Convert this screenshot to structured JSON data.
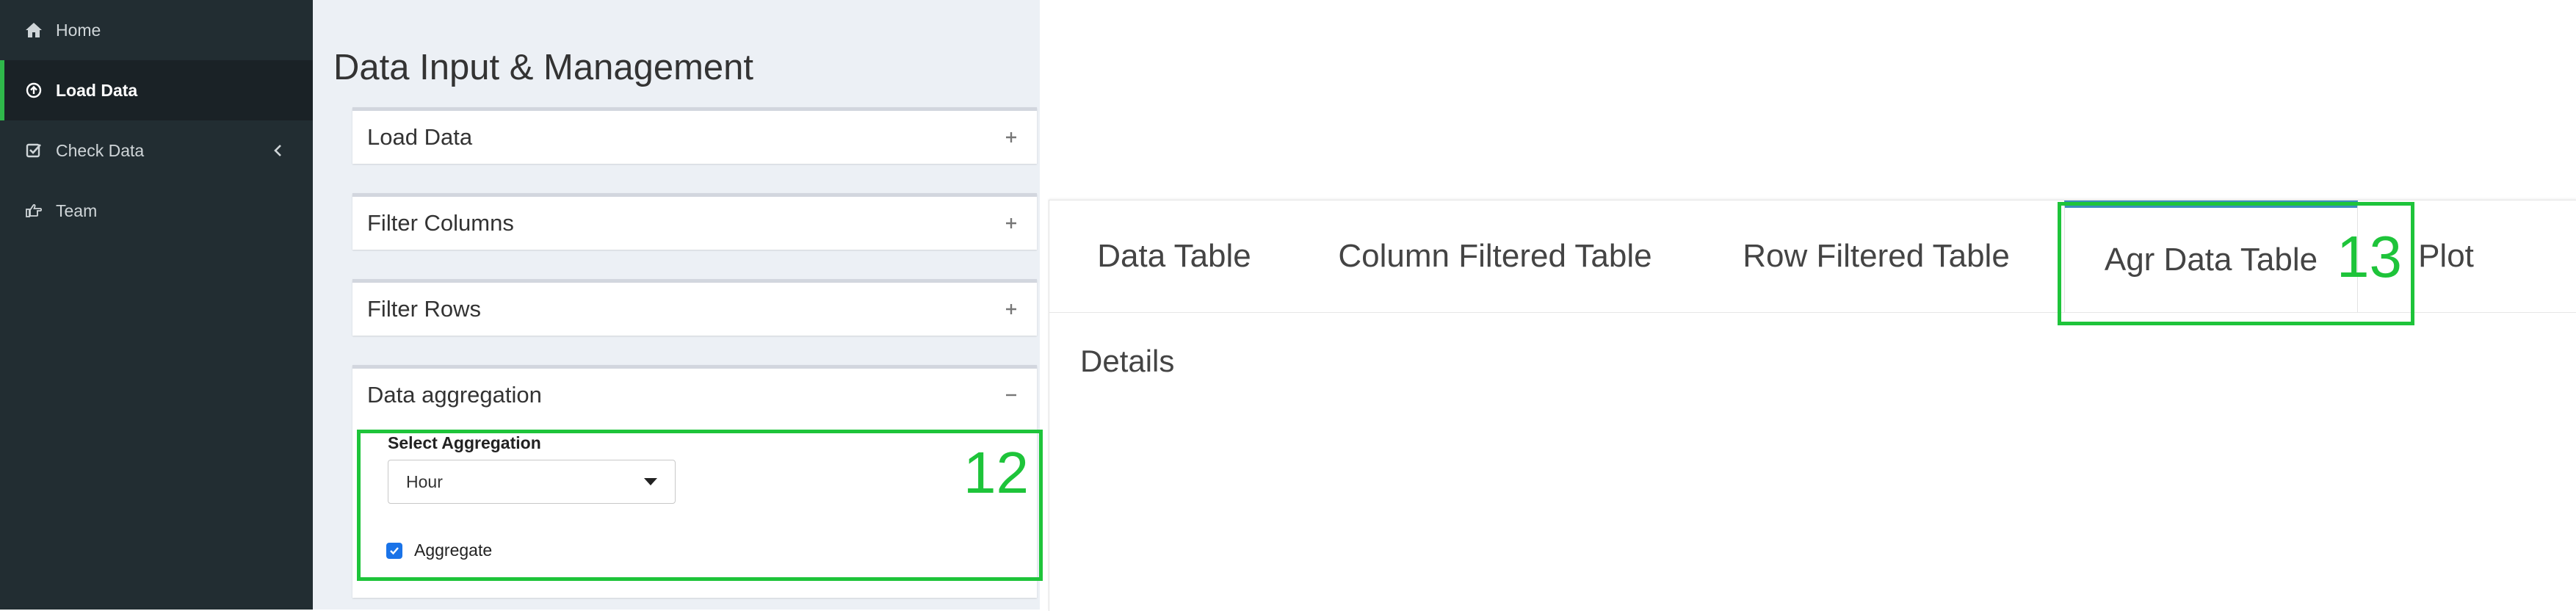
{
  "sidebar": {
    "items": [
      {
        "label": "Home",
        "icon": "home-icon",
        "active": false
      },
      {
        "label": "Load Data",
        "icon": "upload-circle-icon",
        "active": true
      },
      {
        "label": "Check Data",
        "icon": "check-square-icon",
        "active": false,
        "has_submenu": true
      },
      {
        "label": "Team",
        "icon": "hand-pointing-icon",
        "active": false
      }
    ]
  },
  "page": {
    "title": "Data Input & Management"
  },
  "boxes": [
    {
      "title": "Load Data",
      "collapsed": true
    },
    {
      "title": "Filter Columns",
      "collapsed": true
    },
    {
      "title": "Filter Rows",
      "collapsed": true
    },
    {
      "title": "Data aggregation",
      "collapsed": false
    }
  ],
  "aggregation": {
    "select_label": "Select Aggregation",
    "selected_value": "Hour",
    "checkbox_label": "Aggregate",
    "checkbox_checked": true
  },
  "annotations": {
    "left_number": "12",
    "right_number": "13",
    "color": "#1ec43a"
  },
  "tabs": {
    "items": [
      {
        "label": "Data Table",
        "active": false
      },
      {
        "label": "Column Filtered Table",
        "active": false
      },
      {
        "label": "Row Filtered Table",
        "active": false
      },
      {
        "label": "Agr Data Table",
        "active": true
      },
      {
        "label": "Plot",
        "active": false
      }
    ],
    "details_heading": "Details"
  },
  "colors": {
    "sidebar_bg": "#222d32",
    "sidebar_active_accent": "#2fb84a",
    "content_bg": "#ecf0f5",
    "tab_active_accent": "#3c8dbc",
    "checkbox": "#1a73e8"
  }
}
